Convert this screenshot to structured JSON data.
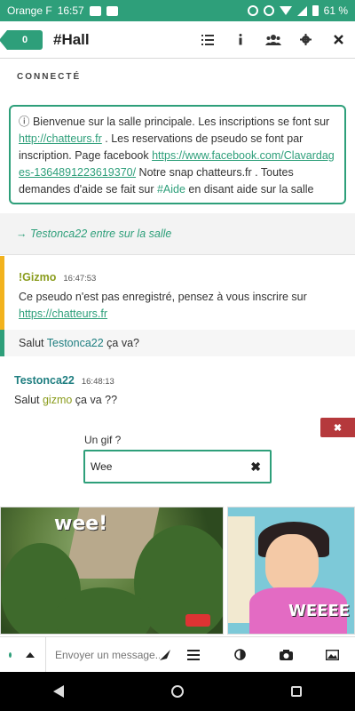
{
  "status_bar": {
    "carrier": "Orange F",
    "time": "16:57",
    "battery": "61 %"
  },
  "header": {
    "badge_count": "0",
    "room_title": "#Hall"
  },
  "toolbar_icons": [
    "list-icon",
    "info-icon",
    "users-icon",
    "gear-icon",
    "close-icon"
  ],
  "connection_label": "CONNECTÉ",
  "welcome": {
    "text_1": "ⓘ Bienvenue sur la salle principale. Les inscriptions se font sur ",
    "link_1": "http://chatteurs.fr",
    "text_2": " . Les reservations de pseudo se font par inscription. Page facebook ",
    "link_2": "https://www.facebook.com/Clavardages-1364891223619370/",
    "text_3": " Notre snap chatteurs.fr . Toutes demandes d'aide se fait sur ",
    "tag": "#Aide",
    "text_4": " en disant aide sur la salle"
  },
  "entry_notice": "→ Testonca22 entre sur la salle",
  "messages": [
    {
      "author": "!Gizmo",
      "time": "16:47:53",
      "body_text": "Ce pseudo n'est pas enregistré, pensez à vous inscrire sur ",
      "body_link": "https://chatteurs.fr",
      "extra_prefix": "Salut ",
      "extra_mention": "Testonca22",
      "extra_suffix": " ça va?"
    },
    {
      "author": "Testonca22",
      "time": "16:48:13",
      "body_prefix": "Salut ",
      "body_mention": "gizmo",
      "body_suffix": " ça va ??"
    }
  ],
  "gif_search": {
    "label": "Un gif ?",
    "value": "Wee",
    "clear_glyph": "✖",
    "close_glyph": "✖"
  },
  "gifs": [
    {
      "overlay_text": "wee!"
    },
    {
      "overlay_text": "WEEEE"
    }
  ],
  "composer": {
    "placeholder": "Envoyer un message..."
  },
  "colors": {
    "accent": "#2e9f7a",
    "gizmo": "#8a9c1d",
    "testonca": "#1f7e80",
    "warning_bar": "#f2b21d",
    "close_red": "#b5393c"
  }
}
